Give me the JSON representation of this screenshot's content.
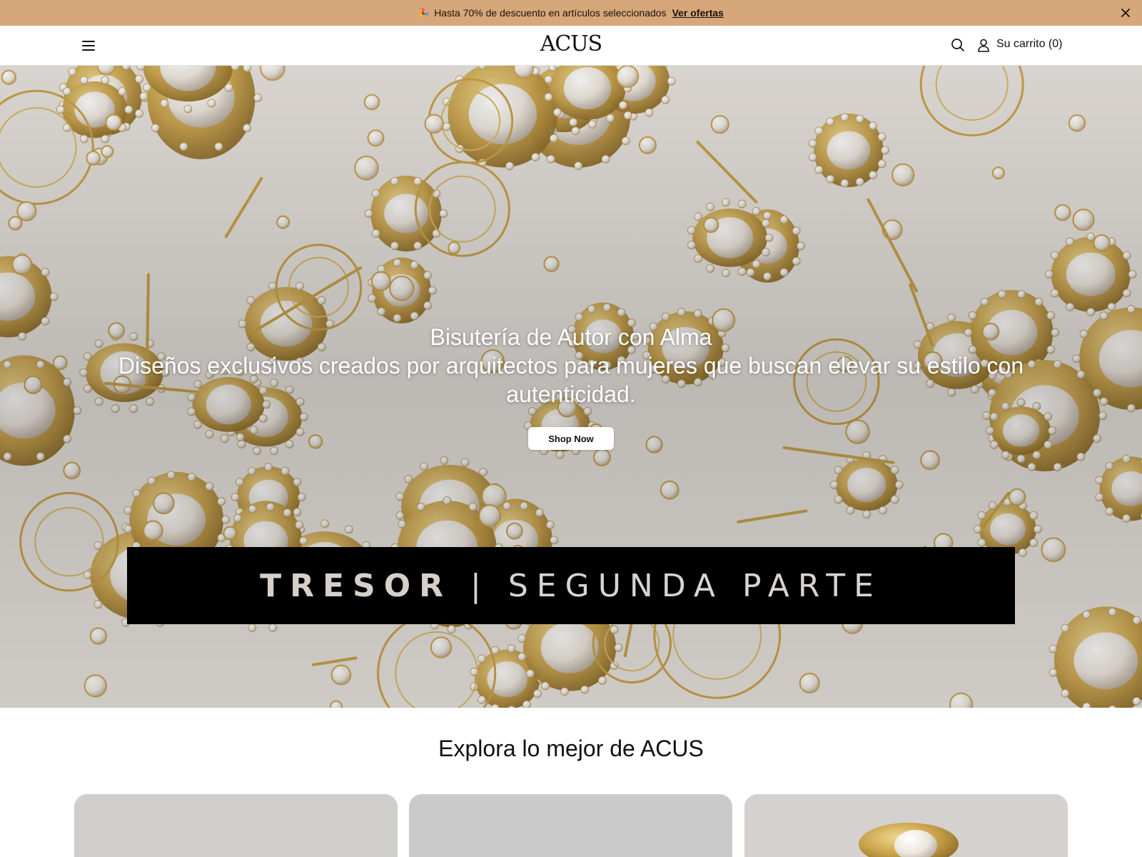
{
  "announcement": {
    "emoji": "🎉",
    "text": "Hasta 70% de descuento en artículos seleccionados",
    "link": "Ver ofertas",
    "close_icon": "close-icon"
  },
  "header": {
    "menu_icon": "hamburger-menu-icon",
    "logo": "ACUS",
    "search_icon": "search-icon",
    "account_icon": "user-icon",
    "cart_label": "Su carrito (0)"
  },
  "hero": {
    "title": "Bisutería de Autor con Alma",
    "subtitle": "Diseños exclusivos creados por arquitectos para mujeres que buscan elevar su estilo con autenticidad.",
    "button": "Shop Now",
    "banner_left": "TRESOR",
    "banner_sep": "|",
    "banner_right": "SEGUNDA PARTE"
  },
  "explore": {
    "title": "Explora lo mejor de ACUS"
  },
  "colors": {
    "announcement_bg": "#d6a77b",
    "banner_bg": "#000000",
    "gold": "#c9a24a"
  }
}
